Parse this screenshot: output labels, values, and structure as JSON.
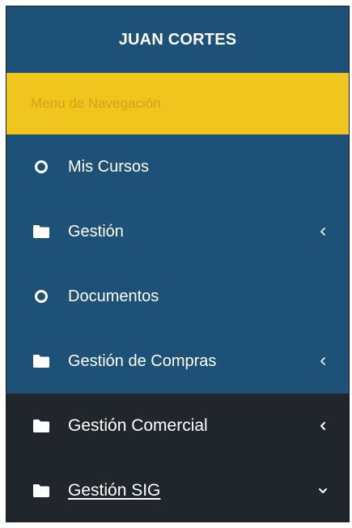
{
  "user": {
    "name": "JUAN CORTES"
  },
  "nav": {
    "header": "Menu de Navegación",
    "items": [
      {
        "label": "Mis Cursos",
        "icon": "circle-icon",
        "chevron": "none"
      },
      {
        "label": "Gestión",
        "icon": "folder-icon",
        "chevron": "left"
      },
      {
        "label": "Documentos",
        "icon": "circle-icon",
        "chevron": "none"
      },
      {
        "label": "Gestión de Compras",
        "icon": "folder-icon",
        "chevron": "left"
      },
      {
        "label": "Gestión Comercial",
        "icon": "folder-icon",
        "chevron": "left"
      },
      {
        "label": "Gestión SIG",
        "icon": "folder-icon",
        "chevron": "down"
      }
    ]
  },
  "colors": {
    "sidebar_bg": "#1e5177",
    "header_accent": "#f0c51e",
    "header_text": "#d89f16",
    "dark_item_bg": "#20262b",
    "text": "#ffffff"
  }
}
